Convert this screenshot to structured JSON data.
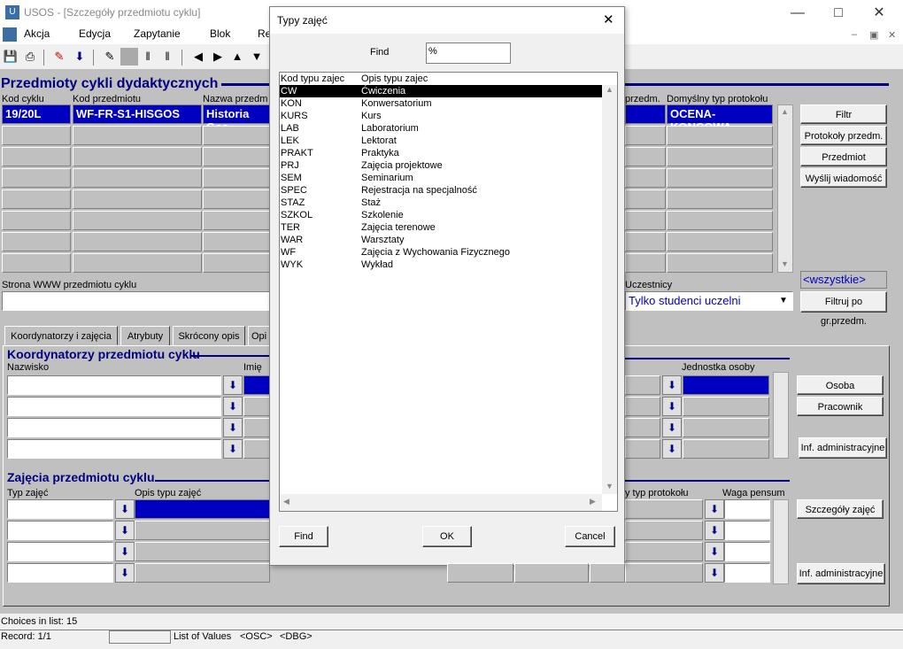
{
  "window": {
    "title": "USOS - [Szczegóły przedmiotu cyklu]"
  },
  "menu": [
    "Akcja",
    "Edycja",
    "Zapytanie",
    "Blok",
    "Re"
  ],
  "form": {
    "title": "Przedmioty cykli dydaktycznych",
    "columns": {
      "kod_cyklu": "Kod cyklu",
      "kod_przedmiotu": "Kod przedmiotu",
      "nazwa": "Nazwa przedm",
      "jedn_przedm": "przedm.",
      "domyslny_typ": "Domyślny typ protokołu"
    },
    "row": {
      "kod_cyklu": "19/20L",
      "kod_przedmiotu": "WF-FR-S1-HISGOS",
      "nazwa": "Historia Gos",
      "domyslny_typ": "OCENA-KONCOWA"
    },
    "buttons": {
      "filtr": "Filtr",
      "protokoly": "Protokoły przedm.",
      "przedmiot": "Przedmiot",
      "wyslij": "Wyślij wiadomość",
      "filtruj": "Filtruj po gr.przedm."
    },
    "www_label": "Strona WWW przedmiotu cyklu",
    "wszystkie": "<wszystkie>",
    "uczestnicy_label": "Uczestnicy",
    "uczestnicy_value": "Tylko studenci uczelni"
  },
  "tabs": [
    "Koordynatorzy i zajęcia",
    "Atrybuty",
    "Skrócony opis",
    "Opi"
  ],
  "koord": {
    "title": "Koordynatorzy przedmiotu cyklu",
    "nazwisko": "Nazwisko",
    "imie": "Imię",
    "jednostka": "Jednostka osoby",
    "btn_osoba": "Osoba",
    "btn_pracownik": "Pracownik",
    "btn_inf": "Inf. administracyjne"
  },
  "zajecia": {
    "title": "Zajęcia przedmiotu cyklu",
    "typ": "Typ zajęć",
    "opis": "Opis typu zajęć",
    "protokol": "y typ protokołu",
    "waga": "Waga pensum",
    "btn_szczegoly": "Szczegóły zajęć",
    "btn_inf": "Inf. administracyjne"
  },
  "status": {
    "choices": "Choices in list: 15",
    "record": "Record: 1/1",
    "lov": "List of Values",
    "osc": "<OSC>",
    "dbg": "<DBG>"
  },
  "dialog": {
    "title": "Typy zajęć",
    "find_label": "Find",
    "find_value": "%",
    "col1": "Kod typu zajec",
    "col2": "Opis typu zajec",
    "items": [
      {
        "kod": "CW",
        "opis": "Ćwiczenia"
      },
      {
        "kod": "KON",
        "opis": "Konwersatorium"
      },
      {
        "kod": "KURS",
        "opis": "Kurs"
      },
      {
        "kod": "LAB",
        "opis": "Laboratorium"
      },
      {
        "kod": "LEK",
        "opis": "Lektorat"
      },
      {
        "kod": "PRAKT",
        "opis": "Praktyka"
      },
      {
        "kod": "PRJ",
        "opis": "Zajęcia projektowe"
      },
      {
        "kod": "SEM",
        "opis": "Seminarium"
      },
      {
        "kod": "SPEC",
        "opis": "Rejestracja na specjalność"
      },
      {
        "kod": "STAZ",
        "opis": "Staż"
      },
      {
        "kod": "SZKOL",
        "opis": "Szkolenie"
      },
      {
        "kod": "TER",
        "opis": "Zajęcia terenowe"
      },
      {
        "kod": "WAR",
        "opis": "Warsztaty"
      },
      {
        "kod": "WF",
        "opis": "Zajęcia z Wychowania Fizycznego"
      },
      {
        "kod": "WYK",
        "opis": "Wykład"
      }
    ],
    "btn_find": "Find",
    "btn_ok": "OK",
    "btn_cancel": "Cancel"
  }
}
